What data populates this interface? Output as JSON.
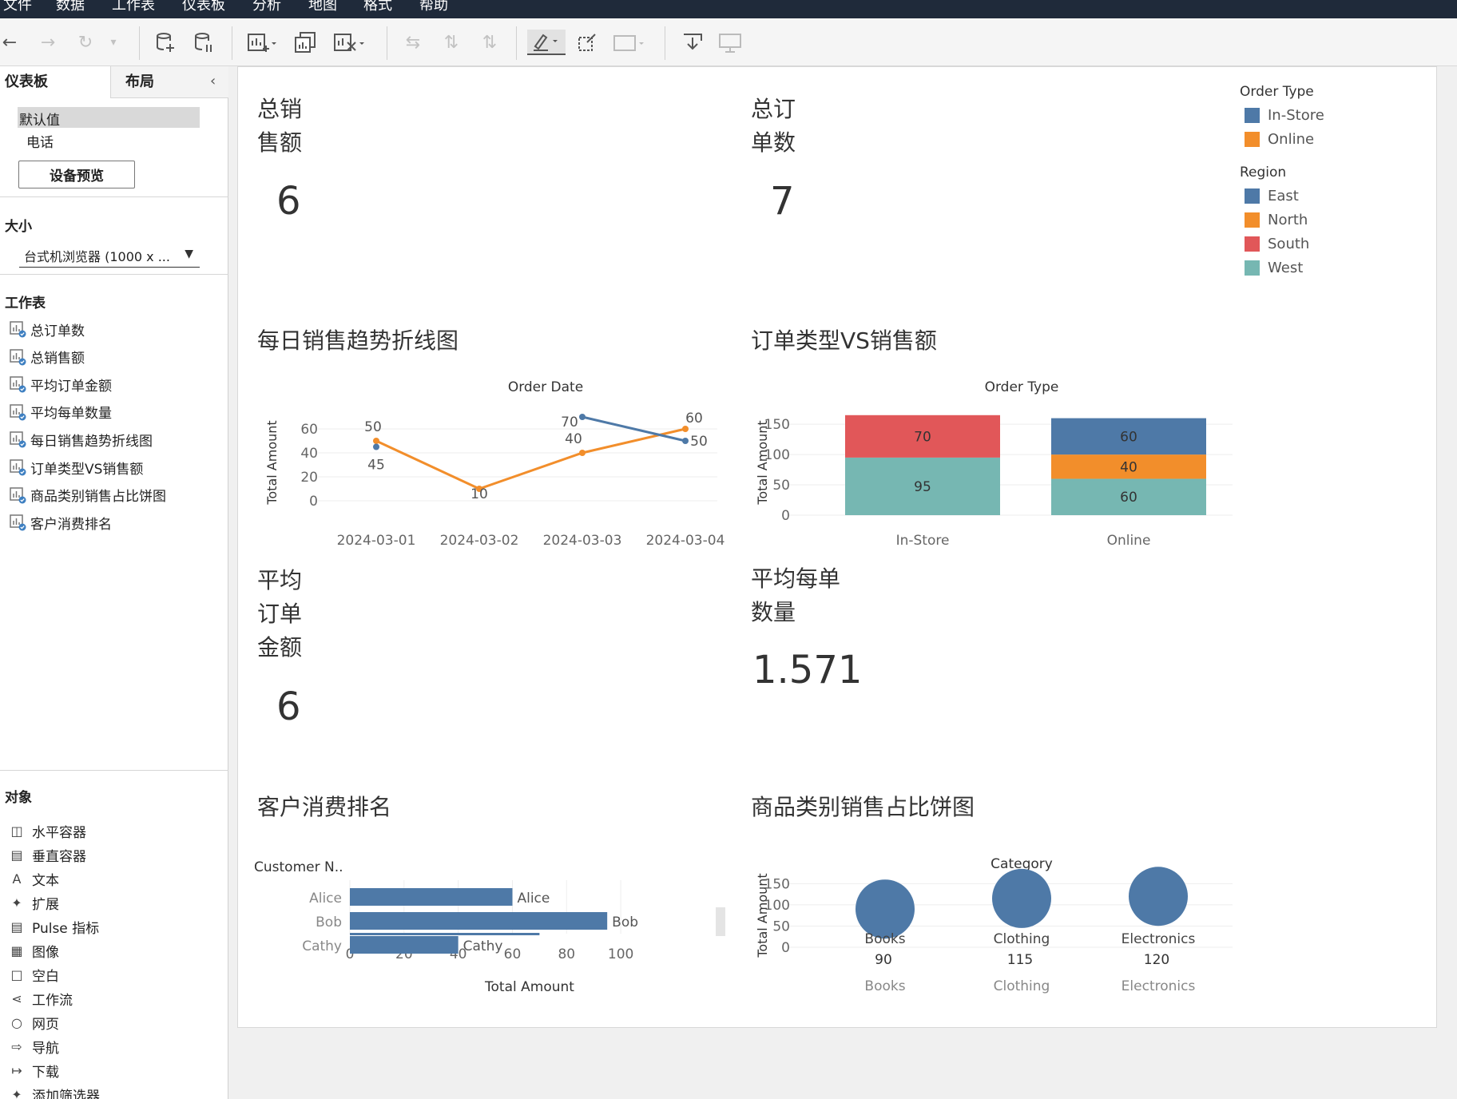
{
  "menu": [
    "文件",
    "数据",
    "工作表",
    "仪表板",
    "分析",
    "地图",
    "格式",
    "帮助"
  ],
  "sidebar": {
    "tabs": [
      "仪表板",
      "布局"
    ],
    "device_options": [
      "默认值",
      "电话"
    ],
    "device_preview_label": "设备预览",
    "size_heading": "大小",
    "size_value": "台式机浏览器 (1000 x ...",
    "worksheets_heading": "工作表",
    "worksheets": [
      "总订单数",
      "总销售额",
      "平均订单金额",
      "平均每单数量",
      "每日销售趋势折线图",
      "订单类型VS销售额",
      "商品类别销售占比饼图",
      "客户消费排名"
    ],
    "objects_heading": "对象",
    "objects": [
      {
        "label": "水平容器",
        "icon": "horizontal-container-icon"
      },
      {
        "label": "垂直容器",
        "icon": "vertical-container-icon"
      },
      {
        "label": "文本",
        "icon": "text-icon"
      },
      {
        "label": "扩展",
        "icon": "extension-icon"
      },
      {
        "label": "Pulse 指标",
        "icon": "pulse-metric-icon"
      },
      {
        "label": "图像",
        "icon": "image-icon"
      },
      {
        "label": "空白",
        "icon": "blank-icon"
      },
      {
        "label": "工作流",
        "icon": "workflow-icon"
      },
      {
        "label": "网页",
        "icon": "web-page-icon"
      },
      {
        "label": "导航",
        "icon": "navigation-icon"
      },
      {
        "label": "下载",
        "icon": "download-icon"
      },
      {
        "label": "添加筛选器",
        "icon": "filter-icon"
      }
    ]
  },
  "dashboard": {
    "kpis": [
      {
        "title": "总销\n售额",
        "value": "6"
      },
      {
        "title": "总订\n单数",
        "value": "7"
      },
      {
        "title": "平均\n订单\n金额",
        "value": "6"
      },
      {
        "title": "平均每单\n数量",
        "value": "1.571"
      }
    ],
    "legends": {
      "order_type": {
        "title": "Order Type",
        "items": [
          {
            "label": "In-Store",
            "color": "#4e79a7"
          },
          {
            "label": "Online",
            "color": "#f28e2b"
          }
        ]
      },
      "region": {
        "title": "Region",
        "items": [
          {
            "label": "East",
            "color": "#4e79a7"
          },
          {
            "label": "North",
            "color": "#f28e2b"
          },
          {
            "label": "South",
            "color": "#e15759"
          },
          {
            "label": "West",
            "color": "#76b7b2"
          }
        ]
      }
    },
    "titles": {
      "line": "每日销售趋势折线图",
      "stack": "订单类型VS销售额",
      "bar": "客户消费排名",
      "bubble": "商品类别销售占比饼图"
    }
  },
  "chart_data": [
    {
      "type": "line",
      "title": "每日销售趋势折线图",
      "header": "Order Date",
      "ylabel": "Total Amount",
      "x": [
        "2024-03-01",
        "2024-03-02",
        "2024-03-03",
        "2024-03-04"
      ],
      "yticks": [
        0,
        20,
        40,
        60
      ],
      "ylim": [
        0,
        70
      ],
      "series": [
        {
          "color": "#f28e2b",
          "values": [
            50,
            10,
            40,
            60
          ]
        },
        {
          "color": "#4e79a7",
          "values": [
            45,
            null,
            70,
            50
          ]
        }
      ]
    },
    {
      "type": "bar",
      "stacked": true,
      "title": "订单类型VS销售额",
      "header": "Order Type",
      "ylabel": "Total Amount",
      "categories": [
        "In-Store",
        "Online"
      ],
      "yticks": [
        0,
        50,
        100,
        150
      ],
      "ylim": [
        0,
        170
      ],
      "series": [
        {
          "name": "West",
          "color": "#76b7b2",
          "values": [
            95,
            60
          ]
        },
        {
          "name": "North",
          "color": "#f28e2b",
          "values": [
            0,
            40
          ]
        },
        {
          "name": "South",
          "color": "#e15759",
          "values": [
            70,
            0
          ]
        },
        {
          "name": "East",
          "color": "#4e79a7",
          "values": [
            0,
            60
          ]
        }
      ]
    },
    {
      "type": "bar",
      "orientation": "horizontal",
      "title": "客户消费排名",
      "header": "Customer N..",
      "xlabel": "Total Amount",
      "categories": [
        "Alice",
        "Bob",
        "Cathy"
      ],
      "values": [
        60,
        95,
        40
      ],
      "xticks": [
        0,
        20,
        40,
        60,
        80,
        100
      ],
      "xlim": [
        0,
        115
      ],
      "color": "#4e79a7"
    },
    {
      "type": "scatter",
      "title": "商品类别销售占比饼图",
      "header": "Category",
      "ylabel": "Total Amount",
      "categories": [
        "Books",
        "Clothing",
        "Electronics"
      ],
      "values": [
        90,
        115,
        120
      ],
      "yticks": [
        0,
        50,
        100,
        150
      ],
      "ylim": [
        0,
        160
      ],
      "color": "#4e79a7"
    }
  ]
}
